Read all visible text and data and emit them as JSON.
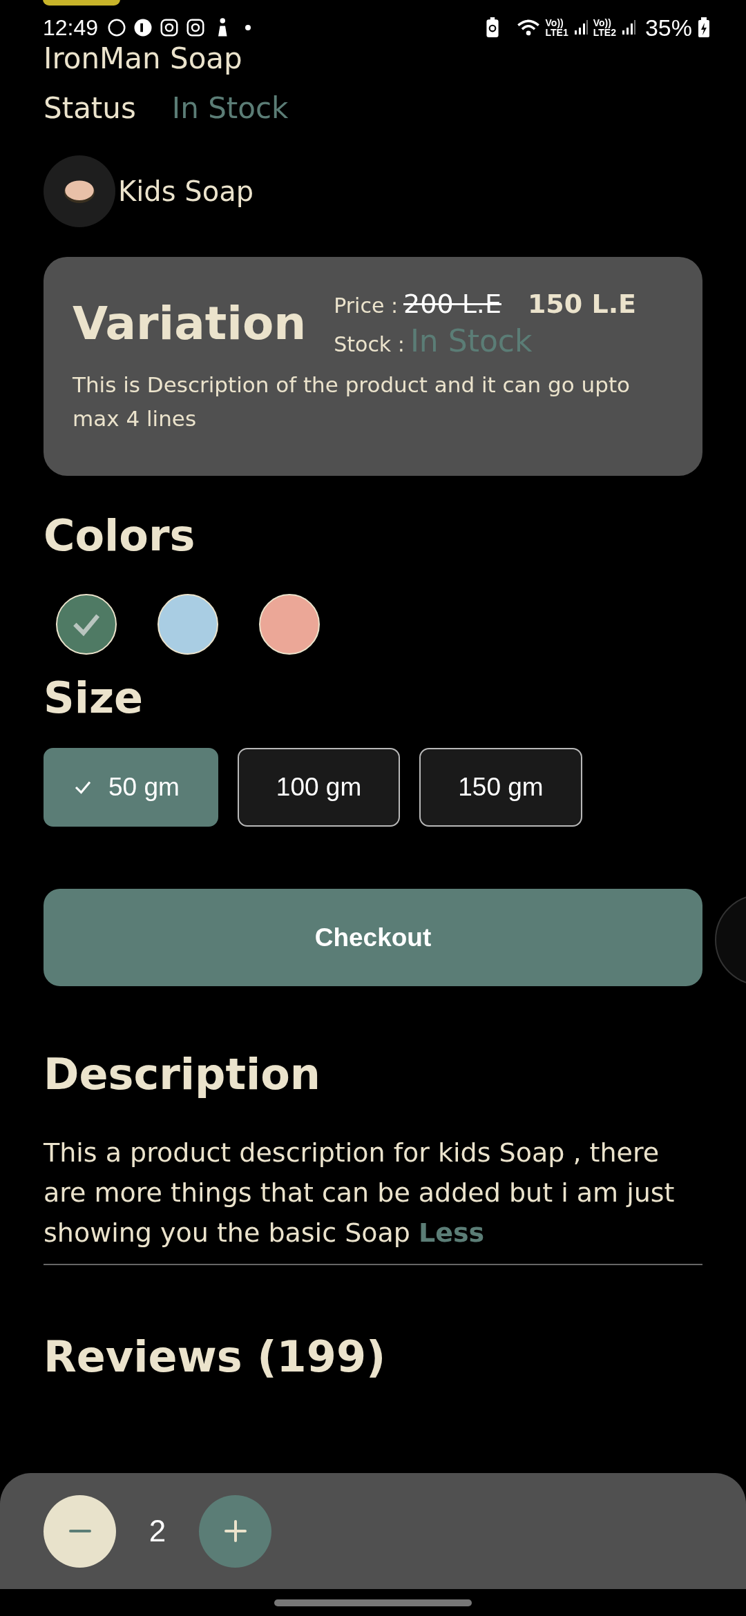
{
  "status_bar": {
    "time": "12:49",
    "sims": [
      {
        "top": "Vo))",
        "bottom": "LTE1"
      },
      {
        "top": "Vo))",
        "bottom": "LTE2"
      }
    ],
    "battery": "35%"
  },
  "product": {
    "title": "IronMan Soap",
    "status_label": "Status",
    "status_value": "In Stock",
    "category": "Kids Soap"
  },
  "variation": {
    "title": "Variation",
    "price_label": "Price :",
    "old_price": "200 L.E",
    "price": "150 L.E",
    "stock_label": "Stock :",
    "stock_value": "In Stock",
    "description": "This is Description of the product and it can go upto max 4 lines"
  },
  "colors": {
    "title": "Colors",
    "items": [
      {
        "color": "#4f7a64",
        "selected": true
      },
      {
        "color": "#a9cde3",
        "selected": false
      },
      {
        "color": "#eba797",
        "selected": false
      }
    ]
  },
  "size": {
    "title": "Size",
    "items": [
      {
        "label": "50 gm",
        "selected": true
      },
      {
        "label": "100 gm",
        "selected": false
      },
      {
        "label": "150 gm",
        "selected": false
      }
    ]
  },
  "checkout_button": "Checkout",
  "description": {
    "title": "Description",
    "text": "This a product description for kids Soap , there are more things that can be added but i am just showing you the basic Soap",
    "link": "Less"
  },
  "reviews": {
    "title": "Reviews (199)"
  },
  "quantity": {
    "value": "2"
  }
}
